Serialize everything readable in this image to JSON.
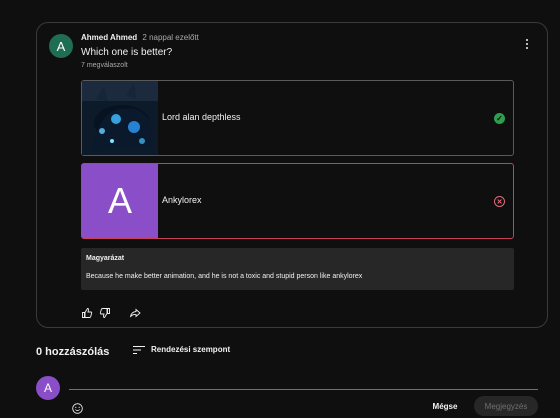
{
  "post": {
    "avatar_letter": "A",
    "author": "Ahmed Ahmed",
    "time": "2 nappal ezelőtt",
    "question": "Which one is better?",
    "answers_count": "7 megválaszolt",
    "options": [
      {
        "label": "Lord alan depthless",
        "status": "correct",
        "status_icon": "check-icon",
        "status_color": "#2e9e4f"
      },
      {
        "label": "Ankylorex",
        "status": "wrong",
        "status_icon": "cross-icon",
        "status_color": "#e46a7a",
        "thumb_letter": "A",
        "thumb_color": "#8a4fc8"
      }
    ],
    "explanation": {
      "title": "Magyarázat",
      "text": "Because he make better animation, and he is not a toxic and stupid person like ankylorex"
    }
  },
  "comments": {
    "count_label": "0 hozzászólás",
    "sort_label": "Rendezési szempont",
    "user_avatar_letter": "A",
    "input_placeholder": "",
    "cancel_label": "Mégse",
    "submit_label": "Megjegyzés"
  },
  "colors": {
    "background": "#0f0f0f",
    "accent_wrong": "#c7405a",
    "accent_correct": "#2e9e4f",
    "avatar_author": "#1f6e54",
    "avatar_user": "#8a4fc8"
  }
}
